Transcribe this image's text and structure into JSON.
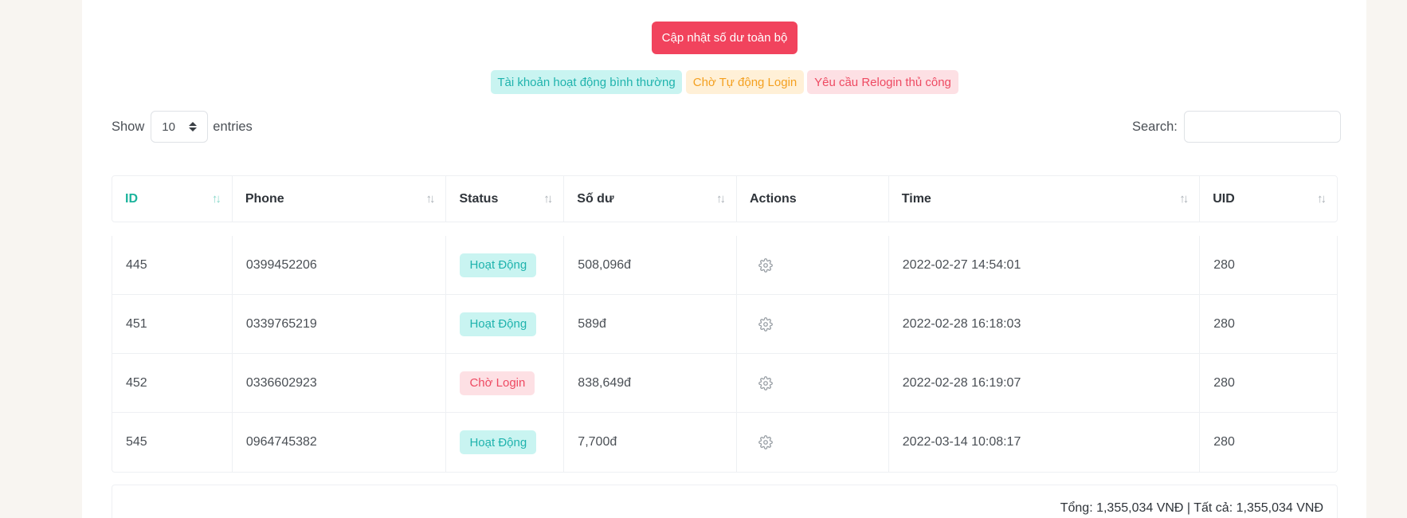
{
  "toolbar": {
    "update_all_label": "Cập nhật số dư toàn bộ"
  },
  "legend": {
    "normal": "Tài khoản hoạt động bình thường",
    "auto_login": "Chờ Tự động Login",
    "manual_relogin": "Yêu cầu Relogin thủ công"
  },
  "length": {
    "show": "Show",
    "value": "10",
    "entries": "entries"
  },
  "search": {
    "label": "Search:",
    "value": ""
  },
  "table": {
    "columns": [
      "ID",
      "Phone",
      "Status",
      "Số dư",
      "Actions",
      "Time",
      "UID"
    ],
    "rows": [
      {
        "id": "445",
        "phone": "0399452206",
        "status": "Hoạt Động",
        "balance": "508,096đ",
        "time": "2022-02-27 14:54:01",
        "uid": "280"
      },
      {
        "id": "451",
        "phone": "0339765219",
        "status": "Hoạt Động",
        "balance": "589đ",
        "time": "2022-02-28 16:18:03",
        "uid": "280"
      },
      {
        "id": "452",
        "phone": "0336602923",
        "status": "Chờ Login",
        "balance": "838,649đ",
        "time": "2022-02-28 16:19:07",
        "uid": "280"
      },
      {
        "id": "545",
        "phone": "0964745382",
        "status": "Hoạt Động",
        "balance": "7,700đ",
        "time": "2022-03-14 10:08:17",
        "uid": "280"
      }
    ]
  },
  "footer": {
    "total": "Tổng: 1,355,034 VNĐ | Tất cả: 1,355,034 VNĐ"
  },
  "colors": {
    "primary_red": "#f1435d",
    "active_green": "#1bb39c",
    "badge_active_bg": "#c9f4f1",
    "badge_wait_bg": "#fde0e4"
  }
}
